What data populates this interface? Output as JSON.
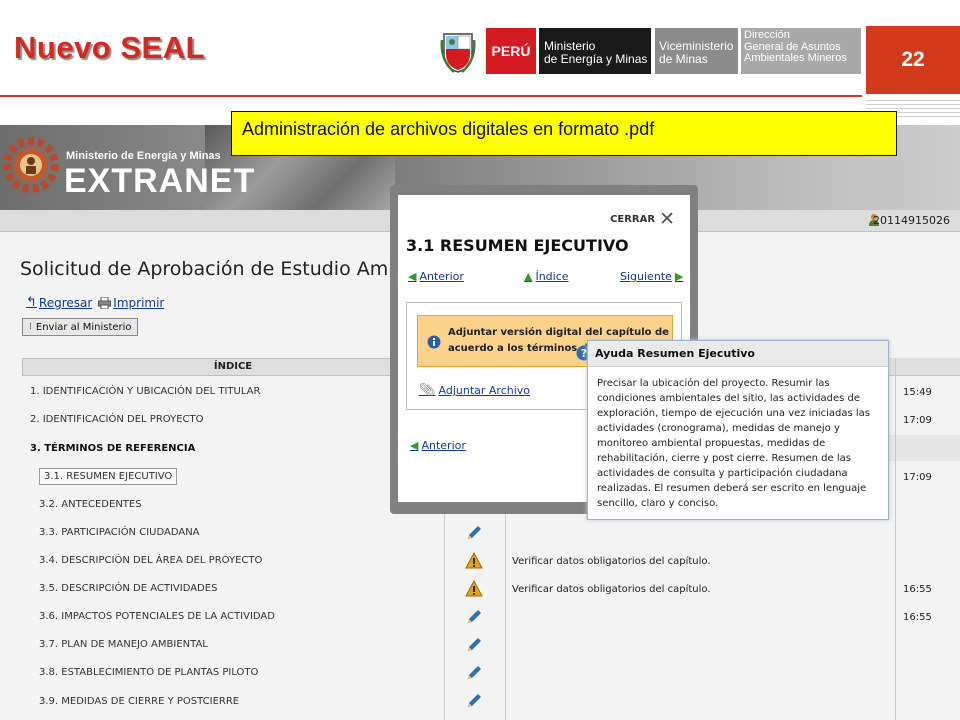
{
  "slide": {
    "title": "Nuevo SEAL",
    "page_number": "22",
    "caption": "Administración de archivos digitales en formato .pdf",
    "gov_logos": {
      "peru": "PERÚ",
      "ministry": [
        "Ministerio",
        "de Energía y Minas"
      ],
      "vice": [
        "Viceministerio",
        "de Minas"
      ],
      "dgaam": [
        "Dirección",
        "General de Asuntos",
        "Ambientales Mineros"
      ]
    }
  },
  "app": {
    "banner": {
      "ministry": "Ministerio de Energía y Minas",
      "product": "EXTRANET"
    },
    "user_id": "20114915026",
    "heading": "Solicitud de Aprobación de Estudio Ambiental",
    "links": {
      "back": "Regresar",
      "print": "Imprimir"
    },
    "send_button": "Enviar al Ministerio",
    "index_header": "ÍNDICE",
    "index_items": [
      "1. IDENTIFICACIÓN Y UBICACIÓN DEL TITULAR",
      "2. IDENTIFICACIÓN DEL PROYECTO",
      "3. TÉRMINOS DE REFERENCIA",
      "3.1. RESUMEN EJECUTIVO",
      "3.2. ANTECEDENTES",
      "3.3. PARTICIPACIÓN CIUDADANA",
      "3.4. DESCRIPCIÓN DEL ÁREA DEL PROYECTO",
      "3.5. DESCRIPCIÓN DE ACTIVIDADES",
      "3.6. IMPACTOS POTENCIALES DE LA ACTIVIDAD",
      "3.7. PLAN DE MANEJO AMBIENTAL",
      "3.8. ESTABLECIMIENTO DE PLANTAS PILOTO",
      "3.9. MEDIDAS DE CIERRE Y POSTCIERRE"
    ],
    "status_messages": {
      "verify": "Verificar datos obligatorios del capítulo."
    },
    "times": {
      "row1": "15:49",
      "row2": "17:09",
      "row31": "17:09",
      "row34": "16:55",
      "row35": "16:55"
    },
    "colors": {
      "accent_red": "#d13b1c",
      "link_blue": "#123a8c",
      "notice_orange": "#fad289",
      "caption_yellow": "#ffff00"
    }
  },
  "modal": {
    "close_label": "CERRAR",
    "title": "3.1 RESUMEN EJECUTIVO",
    "nav": {
      "prev": "Anterior",
      "index": "Índice",
      "next": "Siguiente"
    },
    "notice": "Adjuntar versión digital del capítulo de acuerdo a los términos de referencia.",
    "attach_link": "Adjuntar Archivo",
    "prev_bottom": "Anterior"
  },
  "tooltip": {
    "title": "Ayuda Resumen Ejecutivo",
    "body": "Precisar la ubicación del proyecto. Resumir las condiciones ambientales del sitio, las actividades de exploración, tiempo de ejecución una vez iniciadas las actividades (cronograma), medidas de manejo y monitoreo ambiental propuestas, medidas de rehabilitación, cierre y post cierre. Resumen de las actividades de consulta y participación ciudadana realizadas. El resumen deberá ser escrito en lenguaje sencillo, claro y conciso."
  }
}
